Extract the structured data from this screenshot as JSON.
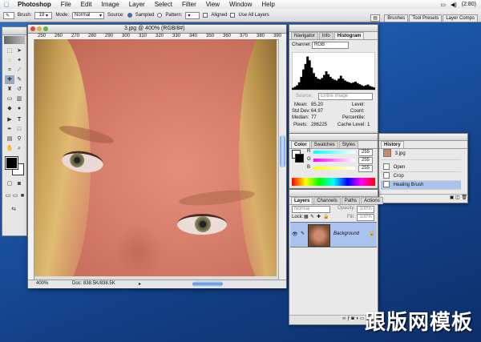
{
  "menubar": {
    "app": "Photoshop",
    "items": [
      "File",
      "Edit",
      "Image",
      "Layer",
      "Select",
      "Filter",
      "View",
      "Window",
      "Help"
    ],
    "battery": "(2:80)"
  },
  "options": {
    "brush_label": "Brush:",
    "brush_size": "19",
    "mode_label": "Mode:",
    "mode_value": "Normal",
    "source_label": "Source:",
    "sampled": "Sampled",
    "pattern": "Pattern:",
    "aligned": "Aligned",
    "use_all_layers": "Use All Layers",
    "well_tabs": [
      "Brushes",
      "Tool Presets",
      "Layer Comps"
    ]
  },
  "document": {
    "title": "3.jpg @ 400% (RGB/8#)",
    "ruler": [
      "250",
      "260",
      "270",
      "280",
      "290",
      "300",
      "310",
      "320",
      "330",
      "340",
      "350",
      "360",
      "370",
      "380",
      "390"
    ],
    "zoom": "400%",
    "doc_size": "Doc: 838.5K/838.5K"
  },
  "navigator": {
    "tabs": [
      "Navigator",
      "Info",
      "Histogram"
    ],
    "channel_label": "Channel:",
    "channel_value": "RGB",
    "source_label": "Source:",
    "source_value": "Entire Image",
    "stats": {
      "mean_label": "Mean:",
      "mean": "85.20",
      "std_label": "Std Dev:",
      "std": "64.97",
      "median_label": "Median:",
      "median": "77",
      "pixels_label": "Pixels:",
      "pixels": "286225",
      "level_label": "Level:",
      "count_label": "Count:",
      "percentile_label": "Percentile:",
      "cache_label": "Cache Level:",
      "cache": "1"
    },
    "histogram": [
      0.05,
      0.08,
      0.12,
      0.2,
      0.35,
      0.55,
      0.7,
      0.9,
      0.8,
      0.6,
      0.45,
      0.35,
      0.3,
      0.28,
      0.32,
      0.4,
      0.5,
      0.42,
      0.35,
      0.3,
      0.27,
      0.25,
      0.3,
      0.38,
      0.3,
      0.25,
      0.22,
      0.2,
      0.18,
      0.2,
      0.22,
      0.18,
      0.15,
      0.12,
      0.1,
      0.12,
      0.14,
      0.1,
      0.08,
      0.06
    ]
  },
  "color": {
    "tabs": [
      "Color",
      "Swatches",
      "Styles"
    ],
    "channels": [
      {
        "label": "R",
        "value": "255",
        "color": "#e02020"
      },
      {
        "label": "G",
        "value": "255",
        "color": "#20b020"
      },
      {
        "label": "B",
        "value": "255",
        "color": "#2040e0"
      }
    ]
  },
  "history": {
    "tab": "History",
    "snapshot": "3.jpg",
    "steps": [
      "Open",
      "Crop",
      "Healing Brush"
    ]
  },
  "layers": {
    "tabs": [
      "Layers",
      "Channels",
      "Paths",
      "Actions"
    ],
    "blend": "Normal",
    "opacity_label": "Opacity:",
    "opacity": "100%",
    "lock_label": "Lock:",
    "fill_label": "Fill:",
    "fill": "100%",
    "layer_name": "Background"
  },
  "watermark": "跟版网模板"
}
